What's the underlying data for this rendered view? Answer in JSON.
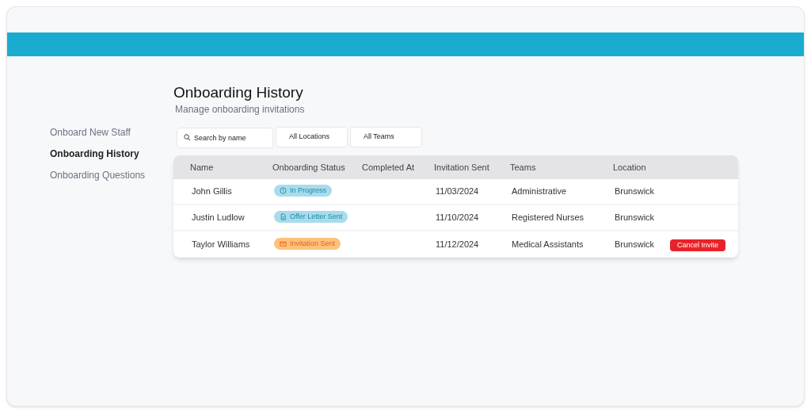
{
  "sidebar": {
    "items": [
      {
        "label": "Onboard New Staff",
        "selected": false
      },
      {
        "label": "Onboarding History",
        "selected": true
      },
      {
        "label": "Onboarding Questions",
        "selected": false
      }
    ]
  },
  "header": {
    "title": "Onboarding History",
    "subtitle": "Manage onboarding invitations"
  },
  "filters": {
    "search": {
      "placeholder": "Search by name"
    },
    "dropdowns": [
      "All Locations",
      "All Teams"
    ]
  },
  "table": {
    "columns": [
      "Name",
      "Onboarding Status",
      "Completed At",
      "Invitation Sent",
      "Teams",
      "Location"
    ],
    "rows": [
      {
        "name": "John Gillis",
        "status": {
          "kind": "progress",
          "label": "In Progress"
        },
        "invitation_sent": "11/03/2024",
        "team": "Administrative",
        "location": "Brunswick"
      },
      {
        "name": "Justin Ludlow",
        "status": {
          "kind": "offer",
          "label": "Offer Letter Sent"
        },
        "invitation_sent": "11/10/2024",
        "team": "Registered Nurses",
        "location": "Brunswick"
      },
      {
        "name": "Taylor Williams",
        "status": {
          "kind": "invitation",
          "label": "Invitation Sent"
        },
        "invitation_sent": "11/12/2024",
        "team": "Medical Assistants",
        "location": "Brunswick",
        "action": "Cancel Invite"
      }
    ]
  }
}
